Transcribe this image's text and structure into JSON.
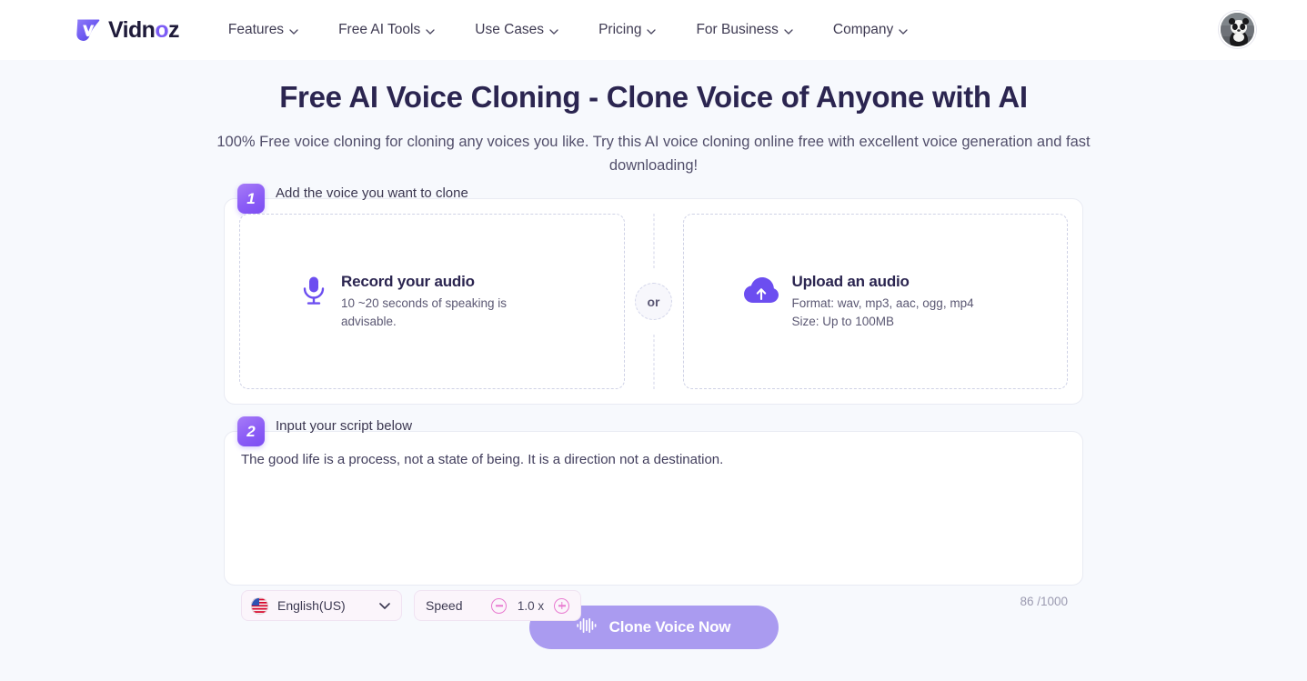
{
  "header": {
    "logo_text": "Vidnoz",
    "logo_icon": "vidnoz-v-logo-icon",
    "nav": [
      {
        "label": "Features",
        "icon": "chevron-down-icon"
      },
      {
        "label": "Free AI Tools",
        "icon": "chevron-down-icon"
      },
      {
        "label": "Use Cases",
        "icon": "chevron-down-icon"
      },
      {
        "label": "Pricing",
        "icon": "chevron-down-icon"
      },
      {
        "label": "For Business",
        "icon": "chevron-down-icon"
      },
      {
        "label": "Company",
        "icon": "chevron-down-icon"
      }
    ],
    "avatar_alt": "user-avatar-panda"
  },
  "hero": {
    "title": "Free AI Voice Cloning - Clone Voice of Anyone with AI",
    "subtitle": "100% Free voice cloning for cloning any voices you like. Try this AI voice cloning online free with excellent voice generation and fast downloading!"
  },
  "step1": {
    "number": "1",
    "label": "Add the voice you want to clone",
    "record": {
      "icon": "microphone-icon",
      "title": "Record your audio",
      "subtitle": "10 ~20 seconds of speaking is advisable."
    },
    "divider_label": "or",
    "upload": {
      "icon": "cloud-upload-icon",
      "title": "Upload an audio",
      "format_line": "Format: wav, mp3, aac, ogg, mp4",
      "size_line": "Size: Up to 100MB"
    }
  },
  "step2": {
    "number": "2",
    "label": "Input your script below",
    "script_value": "The good life is a process, not a state of being. It is a direction not a destination.",
    "script_placeholder": "Input your script below",
    "language": {
      "selected": "English(US)",
      "flag_icon": "us-flag-icon",
      "chevron_icon": "chevron-down-icon"
    },
    "speed": {
      "label": "Speed",
      "value": "1.0 x",
      "minus_icon": "minus-circle-icon",
      "plus_icon": "plus-circle-icon"
    },
    "counter": "86 /1000"
  },
  "cta": {
    "label": "Clone Voice Now",
    "icon": "audio-waveform-icon"
  },
  "colors": {
    "brand_purple": "#7c5cf6",
    "badge_gradient_start": "#a77cf7",
    "badge_gradient_end": "#7c4df2",
    "page_bg": "#f7f9fd",
    "heading": "#2b2550",
    "cta_bg": "#aa9bf0",
    "speed_accent": "#e87ad0"
  }
}
